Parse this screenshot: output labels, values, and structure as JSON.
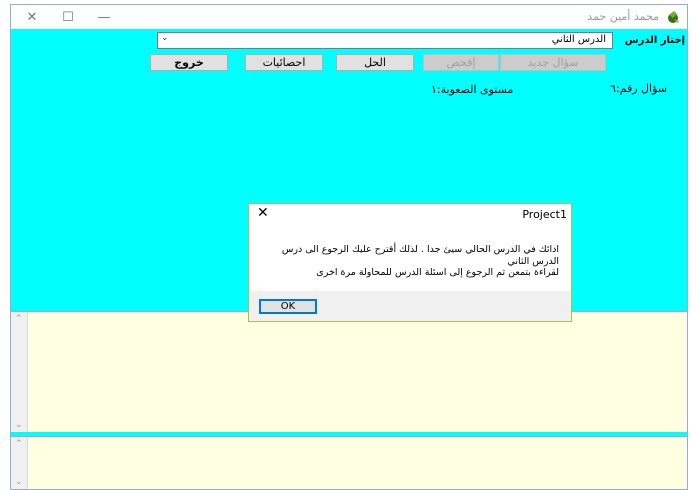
{
  "window": {
    "title": "محمد أمين حمد",
    "icon": "app-logo-icon",
    "controls": {
      "minimize": "—",
      "maximize": "☐",
      "close": "✕"
    }
  },
  "form": {
    "lesson_label": "إختار الدرس",
    "lesson_value": "الدرس الثاني",
    "buttons": {
      "new_question": "سؤال جديد",
      "check": "إفحص",
      "solve": "الحل",
      "statistics": "احصائيات",
      "exit": "خروج"
    },
    "question_number_label": "سؤال رقم:٦",
    "difficulty_label": "مستوى الصعوبة:١"
  },
  "dialog": {
    "title": "Project1",
    "close": "✕",
    "message_line1": "ادائك في الدرس الحالي سيئ جدا . لذلك أقترح عليك الرجوع  الى درس الدرس الثاني",
    "message_line2": "لقراءة بتمعن ثم الرجوع إلى اسئلة الدرس للمحاولة مرة اخرى",
    "ok_label": "OK"
  },
  "colors": {
    "background": "#00ffff",
    "textbox": "#ffffe1",
    "dialog_border": "#a8c44a"
  }
}
